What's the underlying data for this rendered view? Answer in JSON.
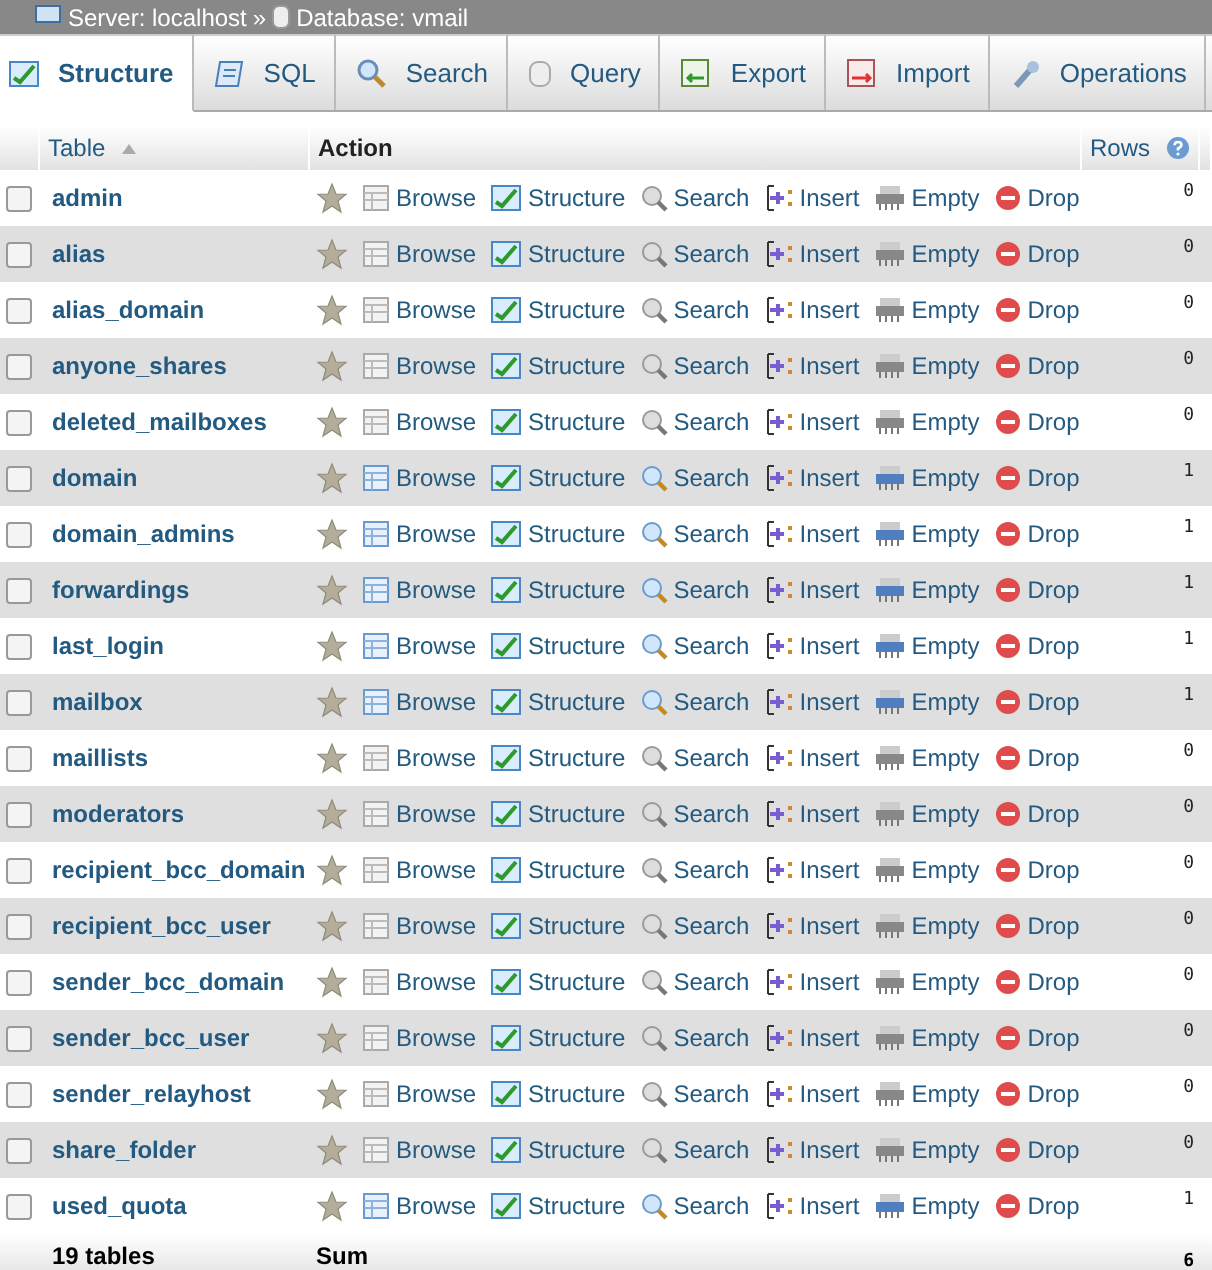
{
  "breadcrumb": {
    "server": "Server: localhost",
    "separator": "»",
    "database": "Database: vmail"
  },
  "tabs": [
    {
      "label": "Structure",
      "selected": true
    },
    {
      "label": "SQL",
      "selected": false
    },
    {
      "label": "Search",
      "selected": false
    },
    {
      "label": "Query",
      "selected": false
    },
    {
      "label": "Export",
      "selected": false
    },
    {
      "label": "Import",
      "selected": false
    },
    {
      "label": "Operations",
      "selected": false
    }
  ],
  "table": {
    "columns": [
      "Table",
      "Action",
      "Rows"
    ],
    "rows": [
      {
        "name": "admin",
        "checked": false,
        "empty": true,
        "rows": "0",
        "actions": [
          "Browse",
          "Structure",
          "Search",
          "Insert",
          "Empty",
          "Drop"
        ]
      },
      {
        "name": "alias",
        "checked": false,
        "empty": true,
        "rows": "0",
        "actions": [
          "Browse",
          "Structure",
          "Search",
          "Insert",
          "Empty",
          "Drop"
        ]
      },
      {
        "name": "alias_domain",
        "checked": false,
        "empty": true,
        "rows": "0",
        "actions": [
          "Browse",
          "Structure",
          "Search",
          "Insert",
          "Empty",
          "Drop"
        ]
      },
      {
        "name": "anyone_shares",
        "checked": false,
        "empty": true,
        "rows": "0",
        "actions": [
          "Browse",
          "Structure",
          "Search",
          "Insert",
          "Empty",
          "Drop"
        ]
      },
      {
        "name": "deleted_mailboxes",
        "checked": false,
        "empty": true,
        "rows": "0",
        "actions": [
          "Browse",
          "Structure",
          "Search",
          "Insert",
          "Empty",
          "Drop"
        ]
      },
      {
        "name": "domain",
        "checked": false,
        "empty": false,
        "rows": "1",
        "actions": [
          "Browse",
          "Structure",
          "Search",
          "Insert",
          "Empty",
          "Drop"
        ]
      },
      {
        "name": "domain_admins",
        "checked": false,
        "empty": false,
        "rows": "1",
        "actions": [
          "Browse",
          "Structure",
          "Search",
          "Insert",
          "Empty",
          "Drop"
        ]
      },
      {
        "name": "forwardings",
        "checked": false,
        "empty": false,
        "rows": "1",
        "actions": [
          "Browse",
          "Structure",
          "Search",
          "Insert",
          "Empty",
          "Drop"
        ]
      },
      {
        "name": "last_login",
        "checked": false,
        "empty": false,
        "rows": "1",
        "actions": [
          "Browse",
          "Structure",
          "Search",
          "Insert",
          "Empty",
          "Drop"
        ]
      },
      {
        "name": "mailbox",
        "checked": false,
        "empty": false,
        "rows": "1",
        "actions": [
          "Browse",
          "Structure",
          "Search",
          "Insert",
          "Empty",
          "Drop"
        ]
      },
      {
        "name": "maillists",
        "checked": false,
        "empty": true,
        "rows": "0",
        "actions": [
          "Browse",
          "Structure",
          "Search",
          "Insert",
          "Empty",
          "Drop"
        ]
      },
      {
        "name": "moderators",
        "checked": false,
        "empty": true,
        "rows": "0",
        "actions": [
          "Browse",
          "Structure",
          "Search",
          "Insert",
          "Empty",
          "Drop"
        ]
      },
      {
        "name": "recipient_bcc_domain",
        "checked": false,
        "empty": true,
        "rows": "0",
        "actions": [
          "Browse",
          "Structure",
          "Search",
          "Insert",
          "Empty",
          "Drop"
        ]
      },
      {
        "name": "recipient_bcc_user",
        "checked": false,
        "empty": true,
        "rows": "0",
        "actions": [
          "Browse",
          "Structure",
          "Search",
          "Insert",
          "Empty",
          "Drop"
        ]
      },
      {
        "name": "sender_bcc_domain",
        "checked": false,
        "empty": true,
        "rows": "0",
        "actions": [
          "Browse",
          "Structure",
          "Search",
          "Insert",
          "Empty",
          "Drop"
        ]
      },
      {
        "name": "sender_bcc_user",
        "checked": false,
        "empty": true,
        "rows": "0",
        "actions": [
          "Browse",
          "Structure",
          "Search",
          "Insert",
          "Empty",
          "Drop"
        ]
      },
      {
        "name": "sender_relayhost",
        "checked": false,
        "empty": true,
        "rows": "0",
        "actions": [
          "Browse",
          "Structure",
          "Search",
          "Insert",
          "Empty",
          "Drop"
        ]
      },
      {
        "name": "share_folder",
        "checked": false,
        "empty": true,
        "rows": "0",
        "actions": [
          "Browse",
          "Structure",
          "Search",
          "Insert",
          "Empty",
          "Drop"
        ]
      },
      {
        "name": "used_quota",
        "checked": false,
        "empty": false,
        "rows": "1",
        "actions": [
          "Browse",
          "Structure",
          "Search",
          "Insert",
          "Empty",
          "Drop"
        ]
      }
    ],
    "footer": {
      "count": "19 tables",
      "label": "Sum",
      "rows": "6"
    }
  }
}
